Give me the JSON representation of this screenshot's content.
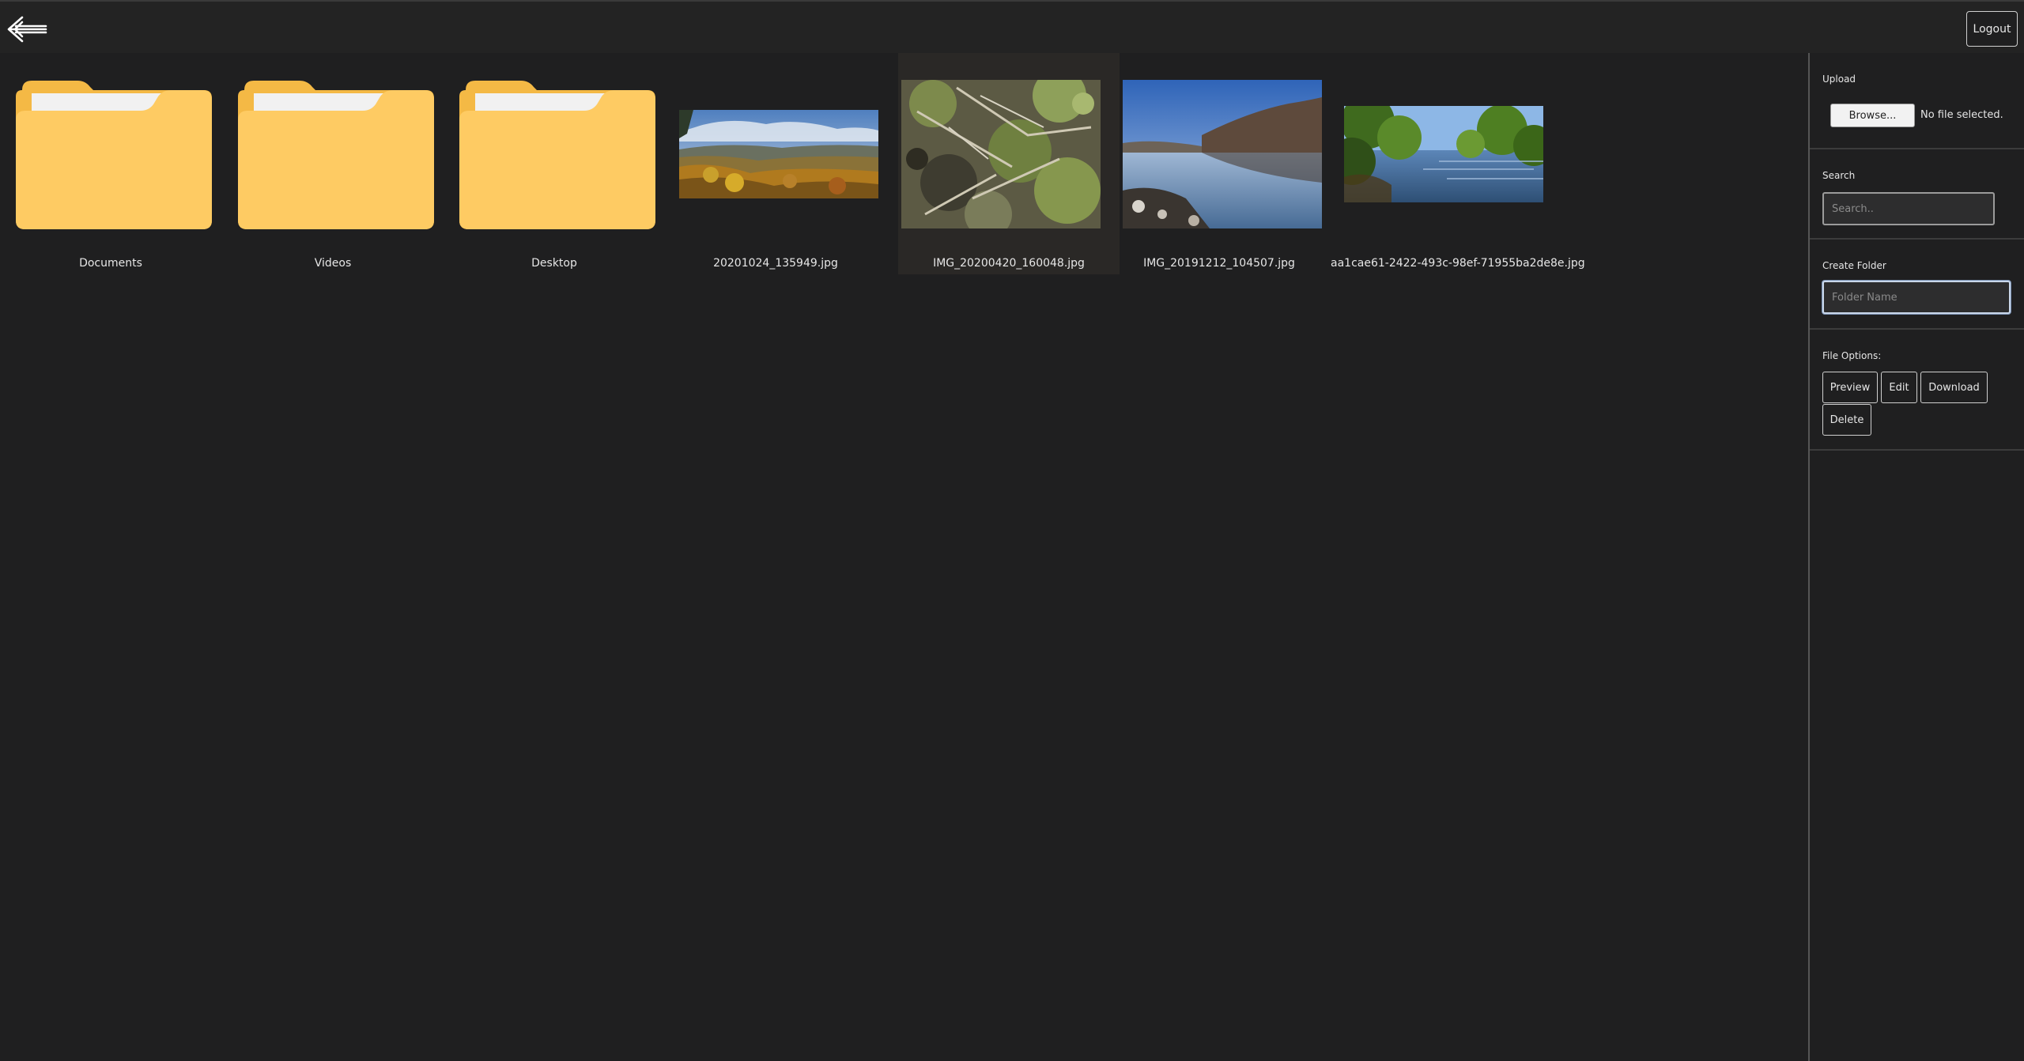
{
  "header": {
    "back_icon": "arrow-left-icon",
    "logout_label": "Logout"
  },
  "items": [
    {
      "type": "folder",
      "name": "Documents"
    },
    {
      "type": "folder",
      "name": "Videos"
    },
    {
      "type": "folder",
      "name": "Desktop"
    },
    {
      "type": "image",
      "name": "20201024_135949.jpg",
      "scene": "autumn valley landscape"
    },
    {
      "type": "image",
      "name": "IMG_20200420_160048.jpg",
      "scene": "forest floor with plants",
      "selected": true
    },
    {
      "type": "image",
      "name": "IMG_20191212_104507.jpg",
      "scene": "calm lake with wooded hills"
    },
    {
      "type": "image",
      "name": "aa1cae61-2422-493c-98ef-71955ba2de8e.jpg",
      "scene": "green trees over river"
    }
  ],
  "sidebar": {
    "upload": {
      "label": "Upload",
      "browse_label": "Browse...",
      "file_status": "No file selected."
    },
    "search": {
      "label": "Search",
      "placeholder": "Search.."
    },
    "create_folder": {
      "label": "Create Folder",
      "placeholder": "Folder Name"
    },
    "file_options": {
      "label": "File Options:",
      "preview": "Preview",
      "edit": "Edit",
      "download": "Download",
      "delete": "Delete"
    }
  },
  "colors": {
    "background": "#1f1f20",
    "folder": "#fecb63",
    "selected_tile": "#2a2826"
  }
}
